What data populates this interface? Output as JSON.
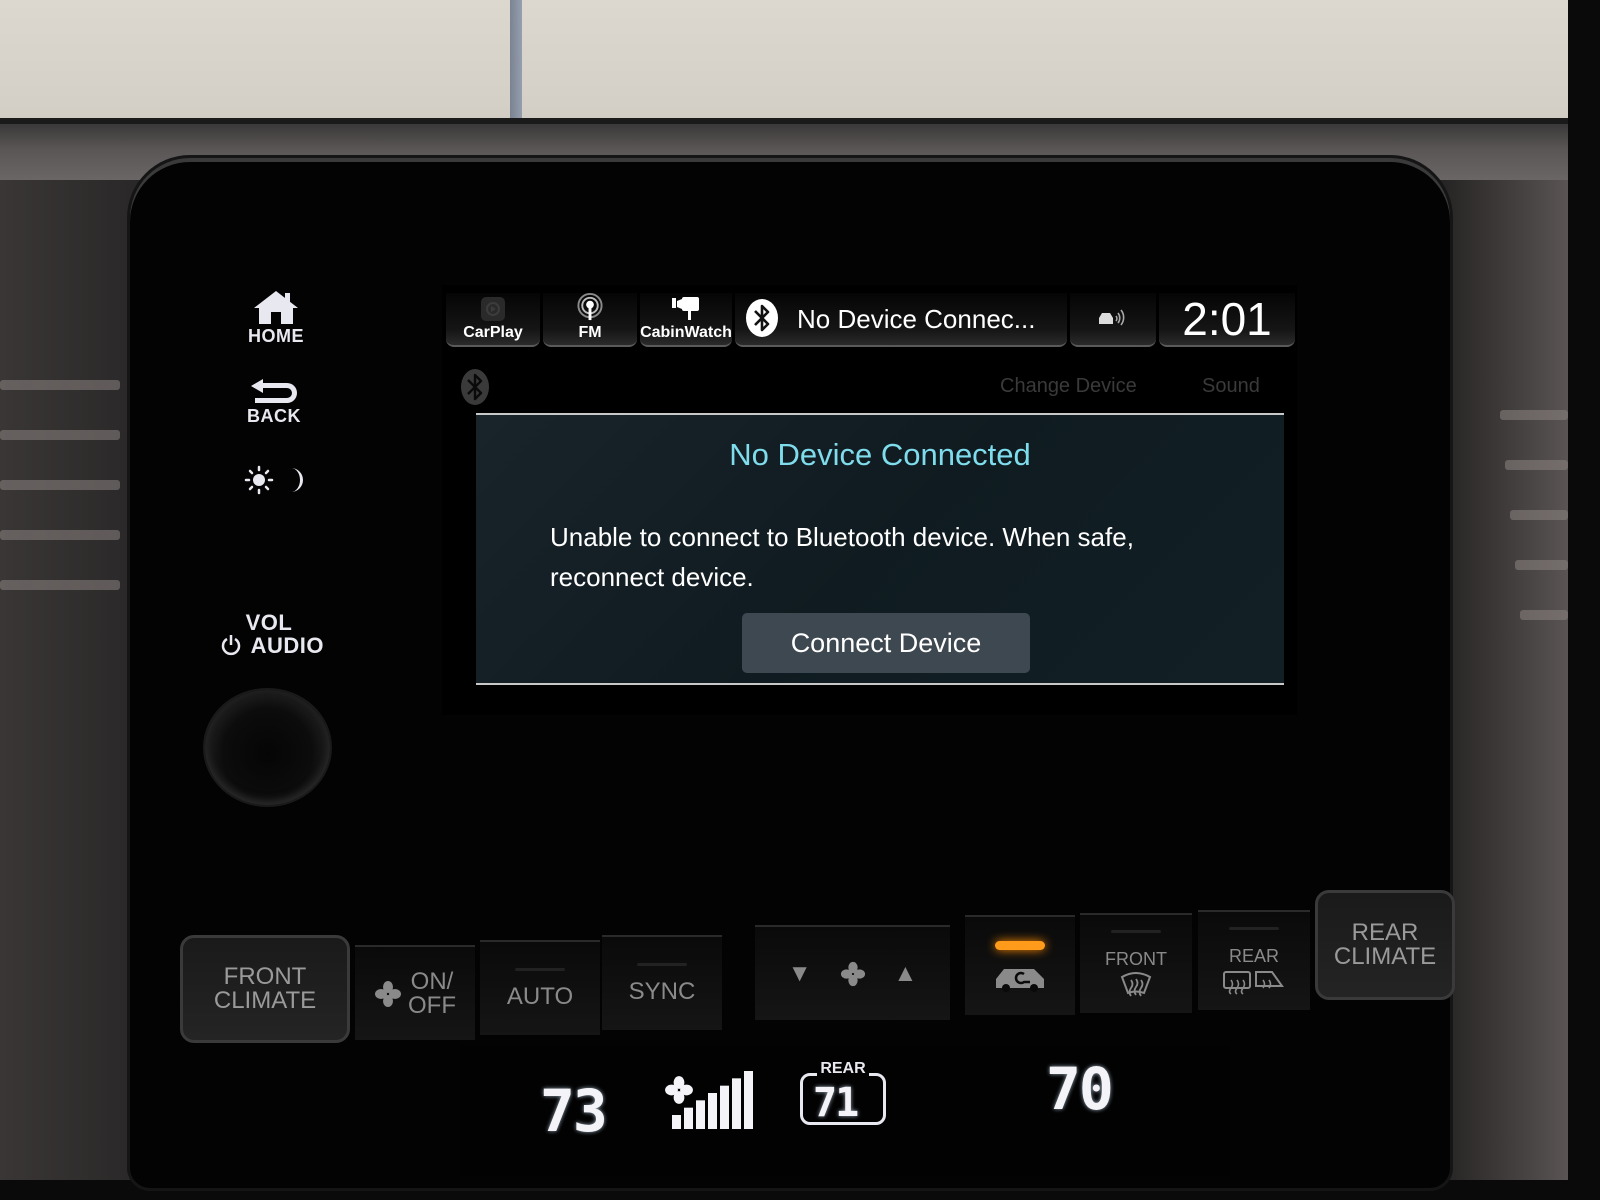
{
  "side_keys": {
    "home_label": "HOME",
    "back_label": "BACK",
    "day_night_icon": "sun-moon-icon",
    "vol_label": "VOL",
    "audio_label": "AUDIO"
  },
  "status_bar": {
    "sources": [
      {
        "label": "CarPlay",
        "icon": "carplay-icon",
        "active": false
      },
      {
        "label": "FM",
        "icon": "fm-radio-icon",
        "active": true
      },
      {
        "label": "CabinWatch",
        "icon": "camera-icon",
        "active": true
      }
    ],
    "bluetooth_icon": "bluetooth-icon",
    "audio_status": "No Device Connec...",
    "connectivity_icon": "car-signal-icon",
    "clock": "2:01"
  },
  "sub_bar": {
    "change_device_label": "Change Device",
    "sound_label": "Sound"
  },
  "dialog": {
    "title": "No Device Connected",
    "message": "Unable to connect to Bluetooth device. When safe, reconnect device.",
    "button_label": "Connect Device",
    "title_color": "#7fdcec"
  },
  "climate": {
    "front_climate": {
      "line1": "FRONT",
      "line2": "CLIMATE"
    },
    "fan_on_off": {
      "line1": "ON/",
      "line2": "OFF"
    },
    "auto_label": "AUTO",
    "sync_label": "SYNC",
    "fan_down": "▼",
    "fan_up": "▲",
    "recirculation_indicator_on": true,
    "indicator_color": "#ff9a1a",
    "front_defrost_label": "FRONT",
    "rear_defrost_label": "REAR",
    "rear_climate": {
      "line1": "REAR",
      "line2": "CLIMATE"
    }
  },
  "climate_display": {
    "driver_temp": "73",
    "fan_speed_level": 7,
    "fan_speed_max": 7,
    "rear_label": "REAR",
    "rear_temp": "71",
    "passenger_temp": "70"
  }
}
